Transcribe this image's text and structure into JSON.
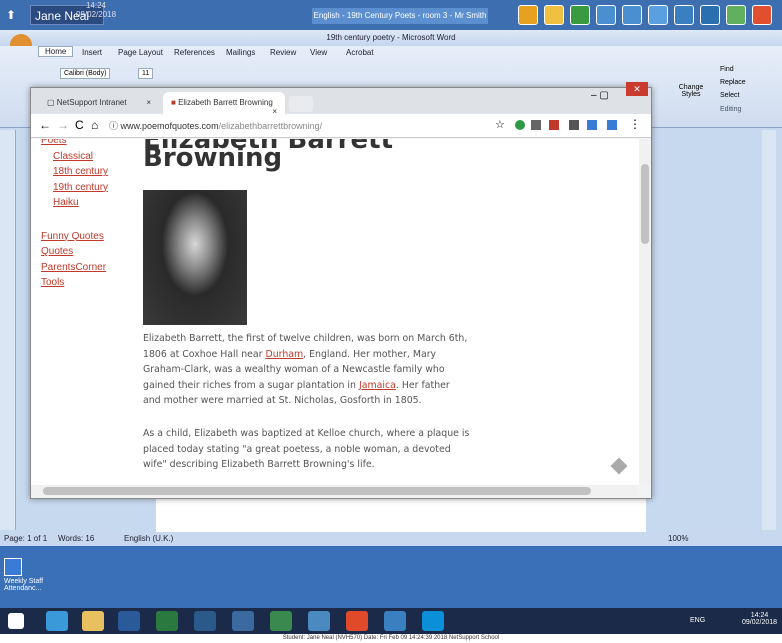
{
  "netsupport": {
    "user": "Jane Neal",
    "time": "14:24",
    "date": "09/02/2018",
    "room_title": "English - 19th Century Poets - room 3 - Mr Smith"
  },
  "word": {
    "title": "19th century poetry - Microsoft Word",
    "tabs": [
      "Home",
      "Insert",
      "Page Layout",
      "References",
      "Mailings",
      "Review",
      "View",
      "Acrobat"
    ],
    "font": "Calibri (Body)",
    "size": "11",
    "find": "Find",
    "replace": "Replace",
    "select": "Select",
    "change_styles": "Change Styles",
    "editing": "Editing",
    "status_page": "Page: 1 of 1",
    "status_words": "Words: 16",
    "status_lang": "English (U.K.)",
    "zoom": "100%"
  },
  "chrome": {
    "tab1": "NetSupport Intranet",
    "tab2": "Elizabeth Barrett Browning",
    "url_domain": "www.poemofquotes.com",
    "url_path": "/elizabethbarrettbrowning/"
  },
  "page": {
    "heading_top": "Elizabeth Barrett",
    "heading": "Browning",
    "nav": [
      "Poets",
      "Classical",
      "18th century",
      "19th century",
      "Haiku",
      "Funny Quotes",
      "Quotes",
      "ParentsCorner",
      "Tools"
    ],
    "p1_a": "Elizabeth Barrett, the first of twelve children, was born on March 6th, 1806 at Coxhoe Hall near ",
    "p1_link1": "Durham",
    "p1_b": ", England. Her mother, Mary Graham-Clark, was a wealthy woman of a Newcastle family who gained their riches from a sugar plantation in ",
    "p1_link2": "Jamaica",
    "p1_c": ". Her father and mother were married at St. Nicholas, Gosforth in 1805.",
    "p2": "As a child, Elizabeth was baptized at Kelloe church, where a plaque is placed today stating \"a great poetess, a noble woman, a devoted wife\" describing Elizabeth Barrett Browning's life."
  },
  "desktop": {
    "icon_label": "Weekly Staff Attendanc..."
  },
  "taskbar": {
    "time": "14:24",
    "date": "09/02/2018",
    "lang": "ENG"
  },
  "footer": "Student: Jane Neal (NVH570)    Date: Fri Feb 09 14:24:39 2018    NetSupport School"
}
